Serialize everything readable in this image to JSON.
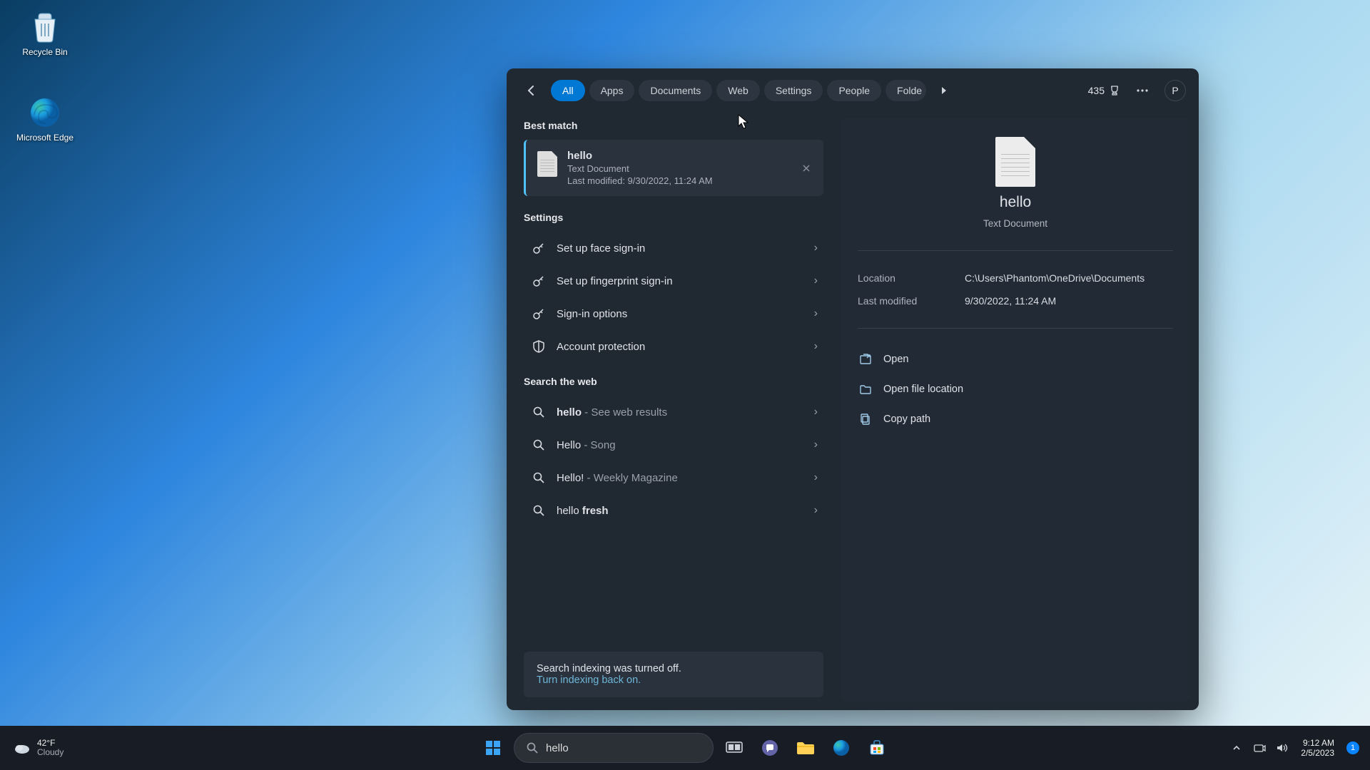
{
  "desktop": {
    "recycle_bin": "Recycle Bin",
    "edge": "Microsoft Edge"
  },
  "search_panel": {
    "filters": [
      "All",
      "Apps",
      "Documents",
      "Web",
      "Settings",
      "People",
      "Folders"
    ],
    "filters_clipped_last": "Folde",
    "points": "435",
    "profile_initial": "P",
    "best_match_header": "Best match",
    "best_match": {
      "title": "hello",
      "type": "Text Document",
      "modified_line": "Last modified: 9/30/2022, 11:24 AM"
    },
    "settings_header": "Settings",
    "settings_items": [
      "Set up face sign-in",
      "Set up fingerprint sign-in",
      "Sign-in options",
      "Account protection"
    ],
    "web_header": "Search the web",
    "web_items": [
      {
        "term": "hello",
        "suffix": " - See web results"
      },
      {
        "term": "Hello",
        "suffix": " - Song"
      },
      {
        "term": "Hello!",
        "suffix": " - Weekly Magazine"
      },
      {
        "term": "hello ",
        "bold_suffix": "fresh"
      }
    ],
    "indexing": {
      "msg": "Search indexing was turned off.",
      "link": "Turn indexing back on."
    },
    "details": {
      "title": "hello",
      "type": "Text Document",
      "location_k": "Location",
      "location_v": "C:\\Users\\Phantom\\OneDrive\\Documents",
      "modified_k": "Last modified",
      "modified_v": "9/30/2022, 11:24 AM",
      "actions": [
        "Open",
        "Open file location",
        "Copy path"
      ]
    }
  },
  "taskbar": {
    "weather_temp": "42°F",
    "weather_cond": "Cloudy",
    "search_value": "hello",
    "time": "9:12 AM",
    "date": "2/5/2023",
    "notif_count": "1"
  }
}
